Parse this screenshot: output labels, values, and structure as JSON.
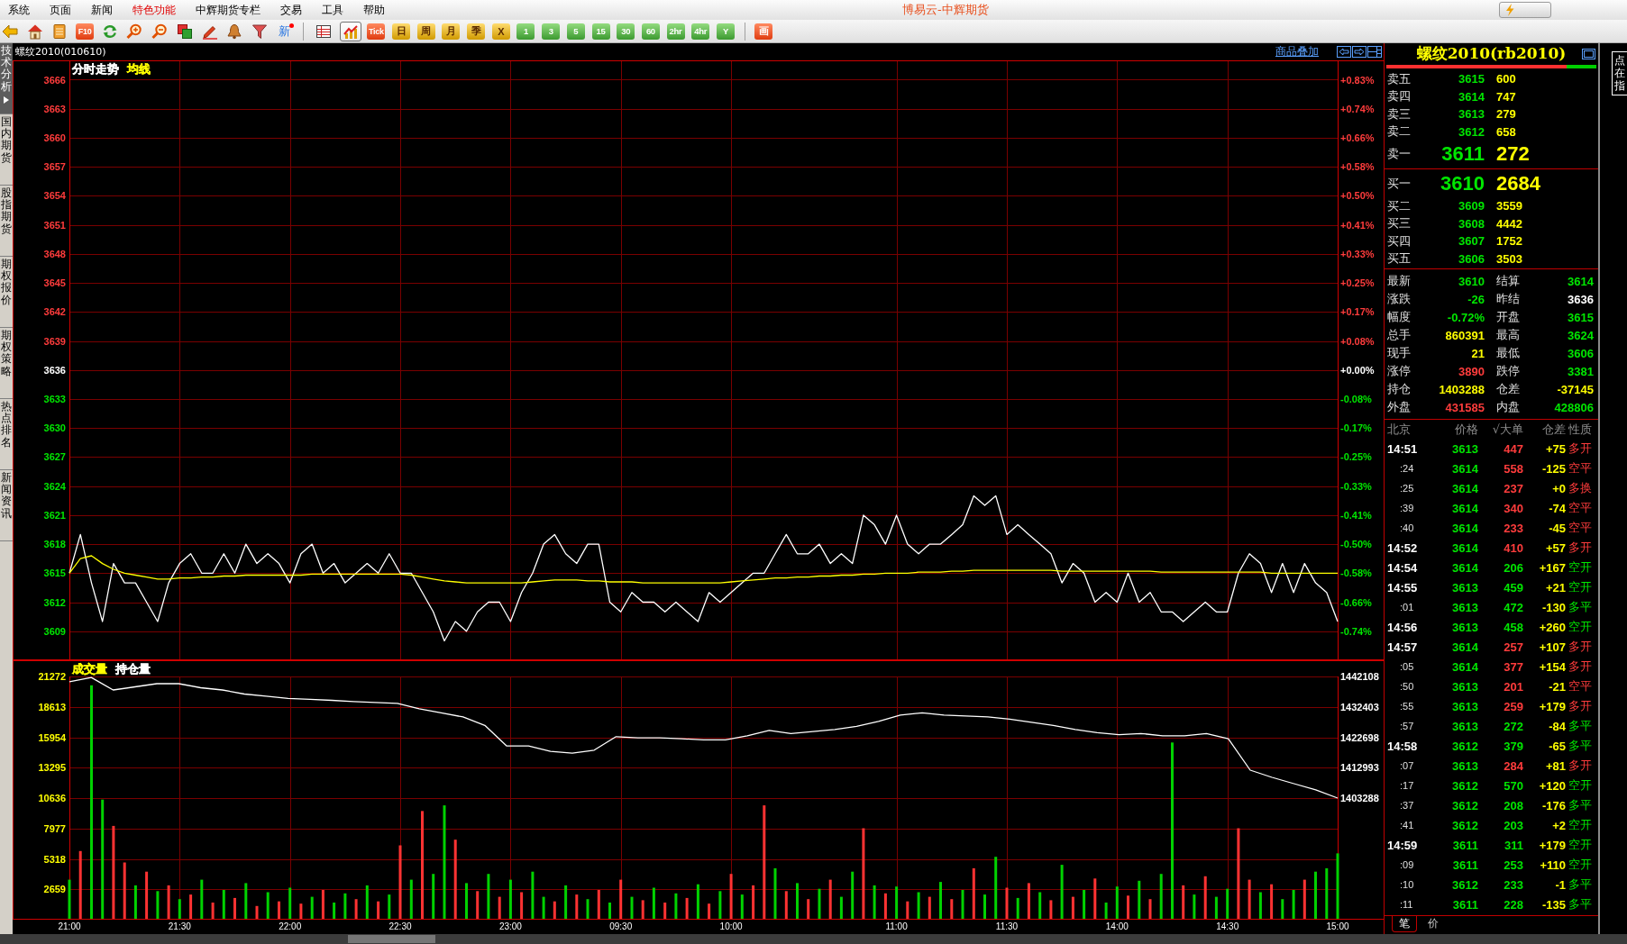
{
  "window": {
    "title": "博易云-中辉期货"
  },
  "menu": [
    {
      "label": "系统",
      "highlighted": false
    },
    {
      "label": "页面",
      "highlighted": false
    },
    {
      "label": "新闻",
      "highlighted": false
    },
    {
      "label": "特色功能",
      "highlighted": true
    },
    {
      "label": "中辉期货专栏",
      "highlighted": false
    },
    {
      "label": "交易",
      "highlighted": false
    },
    {
      "label": "工具",
      "highlighted": false
    },
    {
      "label": "帮助",
      "highlighted": false
    }
  ],
  "toolbar": {
    "f10_button": {
      "label": "F10"
    },
    "new_button": {
      "label": "新",
      "unread": true
    },
    "view_buttons": [
      {
        "selected": false
      },
      {
        "selected": true
      }
    ],
    "period_buttons": [
      {
        "label": "Tick",
        "kind": "tick"
      },
      {
        "label": "日",
        "kind": "calendar"
      },
      {
        "label": "周",
        "kind": "calendar"
      },
      {
        "label": "月",
        "kind": "calendar"
      },
      {
        "label": "季",
        "kind": "calendar"
      },
      {
        "label": "X",
        "kind": "calendar"
      },
      {
        "label": "1",
        "kind": "intraday"
      },
      {
        "label": "3",
        "kind": "intraday"
      },
      {
        "label": "5",
        "kind": "intraday"
      },
      {
        "label": "15",
        "kind": "intraday"
      },
      {
        "label": "30",
        "kind": "intraday"
      },
      {
        "label": "60",
        "kind": "intraday"
      },
      {
        "label": "2hr",
        "kind": "intraday"
      },
      {
        "label": "4hr",
        "kind": "intraday"
      },
      {
        "label": "Y",
        "kind": "intraday"
      }
    ],
    "draw_button": {
      "label": "画"
    }
  },
  "side_tabs": [
    {
      "label": "技术分析",
      "selected": true
    },
    {
      "label": "国内期货",
      "selected": false
    },
    {
      "label": "股指期货",
      "selected": false
    },
    {
      "label": "期权报价",
      "selected": false
    },
    {
      "label": "期权策略",
      "selected": false
    },
    {
      "label": "热点排名",
      "selected": false
    },
    {
      "label": "新闻资讯",
      "selected": false
    }
  ],
  "chart_header": {
    "title": "螺纹2010(010610)",
    "overlay_link": "商品叠加"
  },
  "price_panel": {
    "legend": [
      {
        "label": "分时走势",
        "color": "#ffffff"
      },
      {
        "label": "均线",
        "color": "#ffff00"
      }
    ],
    "percent_labels": [
      "+0.83%",
      "+0.74%",
      "+0.66%",
      "+0.58%",
      "+0.50%",
      "+0.41%",
      "+0.33%",
      "+0.25%",
      "+0.17%",
      "+0.08%",
      "+0.00%",
      "-0.08%",
      "-0.17%",
      "-0.25%",
      "-0.33%",
      "-0.41%",
      "-0.50%",
      "-0.58%",
      "-0.66%",
      "-0.74%"
    ],
    "chart_data": {
      "type": "line",
      "grid": true,
      "categories": [
        null,
        null,
        null,
        null,
        null,
        null,
        null,
        null,
        null,
        null,
        null,
        null,
        null,
        null,
        null,
        null,
        null,
        null,
        null,
        null,
        null,
        null,
        null,
        null,
        null,
        null,
        null,
        null,
        null,
        null,
        null,
        null,
        null,
        null,
        null,
        null,
        null,
        null,
        null,
        null,
        null,
        null,
        null,
        null,
        null,
        null,
        null,
        null,
        null,
        null,
        null,
        null,
        null,
        null,
        null,
        null,
        null,
        null,
        null,
        null,
        null,
        null,
        null,
        null,
        null,
        null,
        null,
        null,
        null,
        null,
        null,
        null,
        null,
        null,
        null,
        null,
        null,
        null,
        null,
        null,
        null,
        null,
        null,
        null,
        null,
        null,
        null,
        null,
        null,
        null,
        null,
        null,
        null,
        null,
        null,
        null,
        null,
        null,
        null,
        null,
        null,
        null,
        null,
        null,
        null,
        null,
        null,
        null,
        null,
        null,
        null,
        null,
        null,
        null,
        null,
        null
      ],
      "ylim": [
        3606,
        3668
      ],
      "yticks": [
        {
          "value": 3609,
          "label": "3609"
        },
        {
          "value": 3612,
          "label": "3612"
        },
        {
          "value": 3615,
          "label": "3615"
        },
        {
          "value": 3618,
          "label": "3618"
        },
        {
          "value": 3621,
          "label": "3621"
        },
        {
          "value": 3624,
          "label": "3624"
        },
        {
          "value": 3627,
          "label": "3627"
        },
        {
          "value": 3630,
          "label": "3630"
        },
        {
          "value": 3633,
          "label": "3633"
        },
        {
          "value": 3636,
          "label": "3636"
        },
        {
          "value": 3639,
          "label": "3639"
        },
        {
          "value": 3642,
          "label": "3642"
        },
        {
          "value": 3645,
          "label": "3645"
        },
        {
          "value": 3648,
          "label": "3648"
        },
        {
          "value": 3651,
          "label": "3651"
        },
        {
          "value": 3654,
          "label": "3654"
        },
        {
          "value": 3657,
          "label": "3657"
        },
        {
          "value": 3660,
          "label": "3660"
        },
        {
          "value": 3663,
          "label": "3663"
        },
        {
          "value": 3666,
          "label": "3666"
        }
      ],
      "series": [
        {
          "color": "#ffffff",
          "values": [
            3615,
            3619,
            3614,
            3610,
            3616,
            3614,
            3614,
            3612,
            3610,
            3614,
            3616,
            3617,
            3615,
            3615,
            3617,
            3615,
            3618,
            3616,
            3617,
            3616,
            3614,
            3617,
            3618,
            3615,
            3616,
            3614,
            3615,
            3616,
            3615,
            3617,
            3615,
            3615,
            3613,
            3611,
            3608,
            3610,
            3609,
            3611,
            3612,
            3612,
            3610,
            3613,
            3615,
            3618,
            3619,
            3617,
            3616,
            3618,
            3618,
            3612,
            3611,
            3613,
            3612,
            3612,
            3611,
            3612,
            3611,
            3610,
            3613,
            3612,
            3613,
            3614,
            3615,
            3615,
            3617,
            3619,
            3617,
            3617,
            3618,
            3616,
            3617,
            3616,
            3621,
            3620,
            3618,
            3621,
            3618,
            3617,
            3618,
            3618,
            3619,
            3620,
            3623,
            3622,
            3623,
            3619,
            3620,
            3619,
            3618,
            3617,
            3614,
            3616,
            3615,
            3612,
            3613,
            3612,
            3615,
            3612,
            3613,
            3611,
            3611,
            3610,
            3611,
            3612,
            3611,
            3611,
            3615,
            3617,
            3616,
            3613,
            3616,
            3613,
            3616,
            3614,
            3613,
            3610
          ]
        },
        {
          "color": "#ffff00",
          "values": [
            3615,
            3616.5,
            3616.8,
            3616,
            3615.4,
            3615,
            3614.8,
            3614.6,
            3614.4,
            3614.4,
            3614.5,
            3614.5,
            3614.6,
            3614.6,
            3614.7,
            3614.7,
            3614.8,
            3614.8,
            3614.8,
            3614.8,
            3614.8,
            3614.8,
            3614.9,
            3614.9,
            3614.9,
            3614.9,
            3614.9,
            3614.9,
            3614.9,
            3614.9,
            3614.9,
            3614.8,
            3614.6,
            3614.4,
            3614.2,
            3614.1,
            3614,
            3614,
            3614,
            3614,
            3614,
            3614,
            3614.1,
            3614.2,
            3614.3,
            3614.3,
            3614.3,
            3614.2,
            3614.2,
            3614.1,
            3614.1,
            3614.1,
            3614,
            3614,
            3614,
            3614,
            3614,
            3614,
            3614,
            3614,
            3614.1,
            3614.2,
            3614.3,
            3614.4,
            3614.5,
            3614.5,
            3614.6,
            3614.6,
            3614.7,
            3614.7,
            3614.8,
            3614.8,
            3614.9,
            3614.9,
            3615,
            3615,
            3615,
            3615.1,
            3615.1,
            3615.1,
            3615.2,
            3615.2,
            3615.3,
            3615.3,
            3615.3,
            3615.3,
            3615.3,
            3615.3,
            3615.3,
            3615.3,
            3615.2,
            3615.2,
            3615.2,
            3615.2,
            3615.2,
            3615.2,
            3615.2,
            3615.2,
            3615.2,
            3615.1,
            3615.1,
            3615.1,
            3615.1,
            3615.1,
            3615.1,
            3615.1,
            3615.1,
            3615.1,
            3615.1,
            3615,
            3615,
            3615,
            3615,
            3615,
            3615,
            3615
          ]
        }
      ]
    }
  },
  "volume_panel": {
    "legend": [
      {
        "label": "成交量",
        "color": "#ffff00"
      },
      {
        "label": "持仓量",
        "color": "#ffffff"
      }
    ],
    "chart_data": {
      "type": "bar",
      "grid": true,
      "categories": [
        "21:00",
        null,
        null,
        null,
        null,
        null,
        null,
        null,
        null,
        null,
        "21:30",
        null,
        null,
        null,
        null,
        null,
        null,
        null,
        null,
        null,
        "22:00",
        null,
        null,
        null,
        null,
        null,
        null,
        null,
        null,
        null,
        "22:30",
        null,
        null,
        null,
        null,
        null,
        null,
        null,
        null,
        null,
        "23:00",
        null,
        null,
        null,
        null,
        null,
        null,
        null,
        null,
        null,
        "09:30",
        null,
        null,
        null,
        null,
        null,
        null,
        null,
        null,
        null,
        "10:00",
        null,
        null,
        null,
        null,
        null,
        null,
        null,
        null,
        null,
        null,
        null,
        null,
        null,
        null,
        "11:00",
        null,
        null,
        null,
        null,
        null,
        null,
        null,
        null,
        null,
        "11:30",
        null,
        null,
        null,
        null,
        null,
        null,
        null,
        null,
        null,
        "14:00",
        null,
        null,
        null,
        null,
        null,
        null,
        null,
        null,
        null,
        "14:30",
        null,
        null,
        null,
        null,
        null,
        null,
        null,
        null,
        null,
        "15:00"
      ],
      "ylim": [
        0,
        21272
      ],
      "yticks": [
        {
          "value": 2659,
          "label": "2659"
        },
        {
          "value": 5318,
          "label": "5318"
        },
        {
          "value": 7977,
          "label": "7977"
        },
        {
          "value": 10636,
          "label": "10636"
        },
        {
          "value": 13295,
          "label": "13295"
        },
        {
          "value": 15954,
          "label": "15954"
        },
        {
          "value": 18613,
          "label": "18613"
        },
        {
          "value": 21272,
          "label": "21272"
        }
      ],
      "series": [
        {
          "color": "#ff3232",
          "values": [
            null,
            6000,
            null,
            null,
            8200,
            5000,
            null,
            4200,
            null,
            3000,
            null,
            2200,
            null,
            1500,
            null,
            1900,
            null,
            1200,
            null,
            1600,
            null,
            1400,
            null,
            2600,
            null,
            null,
            1800,
            null,
            1600,
            null,
            6500,
            null,
            9500,
            null,
            null,
            7000,
            null,
            2500,
            null,
            2000,
            null,
            2400,
            null,
            null,
            1600,
            null,
            2200,
            null,
            2600,
            null,
            3500,
            null,
            1700,
            null,
            1500,
            null,
            1900,
            null,
            1400,
            null,
            4000,
            null,
            3000,
            10000,
            null,
            2500,
            null,
            1800,
            null,
            3500,
            null,
            null,
            8000,
            null,
            2300,
            null,
            1600,
            null,
            2000,
            null,
            1800,
            null,
            4500,
            null,
            null,
            2800,
            null,
            3200,
            null,
            1700,
            null,
            2000,
            null,
            3600,
            null,
            null,
            2100,
            null,
            1800,
            null,
            null,
            3000,
            null,
            3800,
            null,
            null,
            8000,
            3500,
            null,
            3100,
            null,
            null,
            3500,
            null,
            null,
            null
          ]
        },
        {
          "color": "#00d200",
          "values": [
            3500,
            null,
            20500,
            10500,
            null,
            null,
            3000,
            null,
            2500,
            null,
            1800,
            null,
            3500,
            null,
            2600,
            null,
            3200,
            null,
            2400,
            null,
            2800,
            null,
            2000,
            null,
            1500,
            2300,
            null,
            3000,
            null,
            2200,
            null,
            3500,
            null,
            4000,
            10000,
            null,
            3200,
            null,
            4000,
            null,
            3500,
            null,
            4200,
            2000,
            null,
            3000,
            null,
            1800,
            null,
            1500,
            null,
            2000,
            null,
            2800,
            null,
            2300,
            null,
            3100,
            null,
            2500,
            null,
            2200,
            null,
            null,
            4500,
            null,
            3200,
            null,
            2700,
            null,
            2000,
            4200,
            null,
            3000,
            null,
            2900,
            null,
            2400,
            null,
            3300,
            null,
            2600,
            null,
            2200,
            5500,
            null,
            1900,
            null,
            2400,
            null,
            4800,
            null,
            2600,
            null,
            1500,
            2900,
            null,
            3400,
            null,
            4000,
            15500,
            null,
            2200,
            null,
            2000,
            2700,
            null,
            null,
            2400,
            null,
            1800,
            2600,
            null,
            4200,
            4500,
            5800
          ]
        }
      ]
    },
    "open_interest": {
      "chart_data": {
        "type": "line",
        "categories": [
          null,
          null,
          null,
          null,
          null,
          null,
          null,
          null,
          null,
          null,
          null,
          null,
          null,
          null,
          null,
          null,
          null,
          null,
          null,
          null,
          null,
          null,
          null,
          null,
          null,
          null,
          null,
          null,
          null,
          null,
          null,
          null,
          null,
          null,
          null,
          null,
          null,
          null,
          null,
          null,
          null,
          null,
          null,
          null,
          null,
          null,
          null,
          null,
          null,
          null,
          null,
          null,
          null,
          null,
          null,
          null,
          null,
          null,
          null
        ],
        "ylim": [
          1403288,
          1442108
        ],
        "yticks": [
          {
            "value": 1403288,
            "label": "1403288"
          },
          {
            "value": 1412993,
            "label": "1412993"
          },
          {
            "value": 1422698,
            "label": "1422698"
          },
          {
            "value": 1432403,
            "label": "1432403"
          },
          {
            "value": 1442108,
            "label": "1442108"
          }
        ],
        "series": [
          {
            "color": "#ffffff",
            "values": [
              1440400,
              1441800,
              1437800,
              1438800,
              1439800,
              1439800,
              1438500,
              1437800,
              1436500,
              1435800,
              1435100,
              1434800,
              1434500,
              1434100,
              1433800,
              1433500,
              1431800,
              1430500,
              1429200,
              1426500,
              1419900,
              1419900,
              1418200,
              1417600,
              1418600,
              1422900,
              1422500,
              1422500,
              1422200,
              1421900,
              1421900,
              1423200,
              1424900,
              1423900,
              1424500,
              1425200,
              1426200,
              1427800,
              1429800,
              1430500,
              1429800,
              1429500,
              1429200,
              1428500,
              1427500,
              1426500,
              1425200,
              1424200,
              1423500,
              1423900,
              1423200,
              1423200,
              1423900,
              1422200,
              1412200,
              1409900,
              1407900,
              1405900,
              1403300
            ]
          }
        ]
      }
    }
  },
  "quote": {
    "title": "螺纹2010(rb2010)",
    "ratio_bar": {
      "level": 0.86
    },
    "asks": [
      {
        "label": "卖五",
        "price": "3615",
        "volume": "600",
        "kind": "depth"
      },
      {
        "label": "卖四",
        "price": "3614",
        "volume": "747",
        "kind": "depth"
      },
      {
        "label": "卖三",
        "price": "3613",
        "volume": "279",
        "kind": "depth"
      },
      {
        "label": "卖二",
        "price": "3612",
        "volume": "658",
        "kind": "depth"
      },
      {
        "label": "卖一",
        "price": "3611",
        "volume": "272",
        "kind": "best"
      }
    ],
    "bids": [
      {
        "label": "买一",
        "price": "3610",
        "volume": "2684",
        "kind": "best"
      },
      {
        "label": "买二",
        "price": "3609",
        "volume": "3559",
        "kind": "depth"
      },
      {
        "label": "买三",
        "price": "3608",
        "volume": "4442",
        "kind": "depth"
      },
      {
        "label": "买四",
        "price": "3607",
        "volume": "1752",
        "kind": "depth"
      },
      {
        "label": "买五",
        "price": "3606",
        "volume": "3503",
        "kind": "depth"
      }
    ],
    "stats": [
      {
        "label": "最新",
        "value": "3610",
        "color": "#00e600"
      },
      {
        "label": "结算",
        "value": "3614",
        "color": "#00e600"
      },
      {
        "label": "涨跌",
        "value": "-26",
        "color": "#00e600"
      },
      {
        "label": "昨结",
        "value": "3636",
        "color": "#ffffff"
      },
      {
        "label": "幅度",
        "value": "-0.72%",
        "color": "#00e600"
      },
      {
        "label": "开盘",
        "value": "3615",
        "color": "#00e600"
      },
      {
        "label": "总手",
        "value": "860391",
        "color": "#ffff00"
      },
      {
        "label": "最高",
        "value": "3624",
        "color": "#00e600"
      },
      {
        "label": "现手",
        "value": "21",
        "color": "#ffff00"
      },
      {
        "label": "最低",
        "value": "3606",
        "color": "#00e600"
      },
      {
        "label": "涨停",
        "value": "3890",
        "color": "#ff3c3c"
      },
      {
        "label": "跌停",
        "value": "3381",
        "color": "#00e600"
      },
      {
        "label": "持仓",
        "value": "1403288",
        "color": "#ffff00"
      },
      {
        "label": "仓差",
        "value": "-37145",
        "color": "#ffff00"
      },
      {
        "label": "外盘",
        "value": "431585",
        "color": "#ff3c3c"
      },
      {
        "label": "内盘",
        "value": "428806",
        "color": "#00e600"
      }
    ],
    "ticks": {
      "columns": [
        "北京",
        "价格",
        "√大单",
        "仓差",
        "性质"
      ],
      "rows": [
        {
          "time": "14:51",
          "kind": "minute",
          "price": "3613",
          "volume": "447",
          "change": "+75",
          "nature": "多开",
          "color": "#ff3c3c"
        },
        {
          "time": ":24",
          "kind": "second",
          "price": "3614",
          "volume": "558",
          "change": "-125",
          "nature": "空平",
          "color": "#ff3c3c"
        },
        {
          "time": ":25",
          "kind": "second",
          "price": "3614",
          "volume": "237",
          "change": "+0",
          "nature": "多换",
          "color": "#ff3c3c"
        },
        {
          "time": ":39",
          "kind": "second",
          "price": "3614",
          "volume": "340",
          "change": "-74",
          "nature": "空平",
          "color": "#ff3c3c"
        },
        {
          "time": ":40",
          "kind": "second",
          "price": "3614",
          "volume": "233",
          "change": "-45",
          "nature": "空平",
          "color": "#ff3c3c"
        },
        {
          "time": "14:52",
          "kind": "minute",
          "price": "3614",
          "volume": "410",
          "change": "+57",
          "nature": "多开",
          "color": "#ff3c3c"
        },
        {
          "time": "14:54",
          "kind": "minute",
          "price": "3614",
          "volume": "206",
          "change": "+167",
          "nature": "空开",
          "color": "#00e600"
        },
        {
          "time": "14:55",
          "kind": "minute",
          "price": "3613",
          "volume": "459",
          "change": "+21",
          "nature": "空开",
          "color": "#00e600"
        },
        {
          "time": ":01",
          "kind": "second",
          "price": "3613",
          "volume": "472",
          "change": "-130",
          "nature": "多平",
          "color": "#00e600"
        },
        {
          "time": "14:56",
          "kind": "minute",
          "price": "3613",
          "volume": "458",
          "change": "+260",
          "nature": "空开",
          "color": "#00e600"
        },
        {
          "time": "14:57",
          "kind": "minute",
          "price": "3614",
          "volume": "257",
          "change": "+107",
          "nature": "多开",
          "color": "#ff3c3c"
        },
        {
          "time": ":05",
          "kind": "second",
          "price": "3614",
          "volume": "377",
          "change": "+154",
          "nature": "多开",
          "color": "#ff3c3c"
        },
        {
          "time": ":50",
          "kind": "second",
          "price": "3613",
          "volume": "201",
          "change": "-21",
          "nature": "空平",
          "color": "#ff3c3c"
        },
        {
          "time": ":55",
          "kind": "second",
          "price": "3613",
          "volume": "259",
          "change": "+179",
          "nature": "多开",
          "color": "#ff3c3c"
        },
        {
          "time": ":57",
          "kind": "second",
          "price": "3613",
          "volume": "272",
          "change": "-84",
          "nature": "多平",
          "color": "#00e600"
        },
        {
          "time": "14:58",
          "kind": "minute",
          "price": "3612",
          "volume": "379",
          "change": "-65",
          "nature": "多平",
          "color": "#00e600"
        },
        {
          "time": ":07",
          "kind": "second",
          "price": "3613",
          "volume": "284",
          "change": "+81",
          "nature": "多开",
          "color": "#ff3c3c"
        },
        {
          "time": ":17",
          "kind": "second",
          "price": "3612",
          "volume": "570",
          "change": "+120",
          "nature": "空开",
          "color": "#00e600"
        },
        {
          "time": ":37",
          "kind": "second",
          "price": "3612",
          "volume": "208",
          "change": "-176",
          "nature": "多平",
          "color": "#00e600"
        },
        {
          "time": ":41",
          "kind": "second",
          "price": "3612",
          "volume": "203",
          "change": "+2",
          "nature": "空开",
          "color": "#00e600"
        },
        {
          "time": "14:59",
          "kind": "minute",
          "price": "3611",
          "volume": "311",
          "change": "+179",
          "nature": "空开",
          "color": "#00e600"
        },
        {
          "time": ":09",
          "kind": "second",
          "price": "3611",
          "volume": "253",
          "change": "+110",
          "nature": "空开",
          "color": "#00e600"
        },
        {
          "time": ":10",
          "kind": "second",
          "price": "3612",
          "volume": "233",
          "change": "-1",
          "nature": "多平",
          "color": "#00e600"
        },
        {
          "time": ":11",
          "kind": "second",
          "price": "3611",
          "volume": "228",
          "change": "-135",
          "nature": "多平",
          "color": "#00e600"
        }
      ]
    },
    "tabs": [
      {
        "label": "笔",
        "selected": true
      },
      {
        "label": "价",
        "selected": false
      }
    ]
  },
  "side_panel_tab": {
    "label": "点在指"
  }
}
